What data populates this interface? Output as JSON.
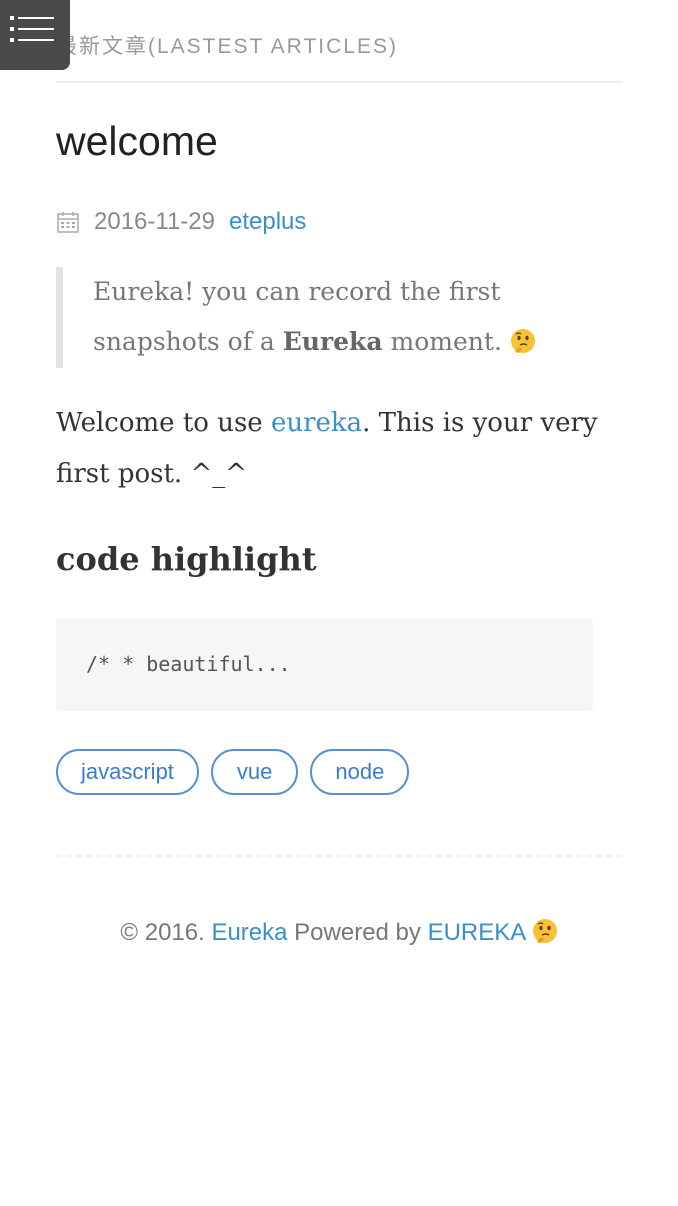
{
  "header": {
    "menu_icon": "hamburger-list-icon",
    "section_title": "最新文章(LASTEST ARTICLES)"
  },
  "post": {
    "title": "welcome",
    "date_icon": "calendar-icon",
    "date": "2016-11-29",
    "author": "eteplus",
    "quote": {
      "line1": "Eureka! you can record the first",
      "line2_pre": "snapshots of a ",
      "line2_bold": "Eureka",
      "line2_post": " moment.",
      "emoji": "thinking-face-emoji"
    },
    "paragraph": {
      "pre": "Welcome to use ",
      "link": "eureka",
      "post": ". This is your very",
      "line2": "first post. ^_^"
    },
    "heading": "code highlight",
    "code": "/* * beautiful...",
    "tags": [
      "javascript",
      "vue",
      "node"
    ]
  },
  "footer": {
    "copyright": "© 2016. ",
    "site_link": "Eureka",
    "powered_by": " Powered by ",
    "engine_link": "EUREKA",
    "emoji": "thinking-face-emoji"
  },
  "colors": {
    "link": "#3b8fc9",
    "tag_border": "#5b8fd0",
    "menu_bg": "#4a4a4a"
  }
}
